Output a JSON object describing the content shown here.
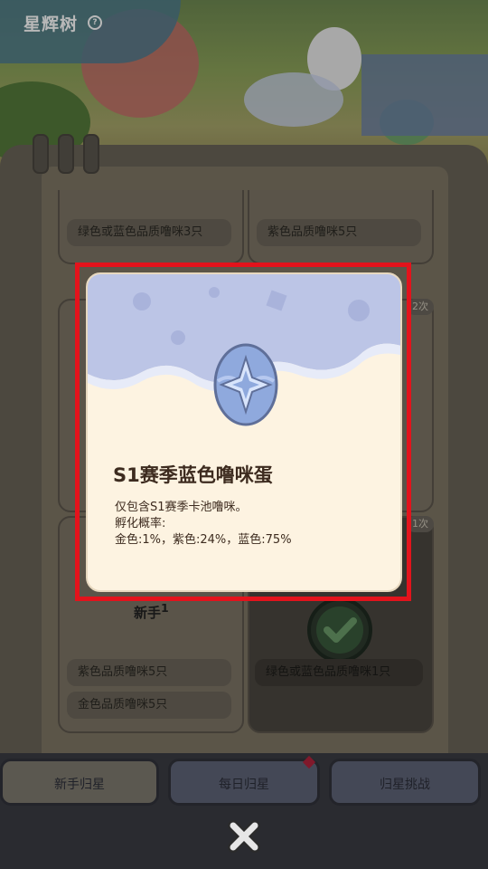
{
  "header": {
    "title": "星辉树",
    "help_icon": "question-icon"
  },
  "cards": {
    "top_left_req": "绿色或蓝色品质噜咪3只",
    "top_right_req": "紫色品质噜咪5只",
    "mid_right_badge": "2次",
    "lower_right_badge": "1次",
    "newbie_label": "新手",
    "newbie_count": "1",
    "bottom_left_req1": "紫色品质噜咪5只",
    "bottom_left_req2": "金色品质噜咪5只",
    "bottom_right_req": "绿色或蓝色品质噜咪1只"
  },
  "tabs": [
    "新手归星",
    "每日归星",
    "归星挑战"
  ],
  "popup": {
    "title": "S1赛季蓝色噜咪蛋",
    "line1": "仅包含S1赛季卡池噜咪。",
    "line2": "孵化概率:",
    "line3": "金色:1%，紫色:24%，蓝色:75%"
  },
  "colors": {
    "highlight_frame": "#e3131c",
    "popup_bg": "#fdf3e1",
    "popup_header": "#b9c3e4",
    "egg": "#8fa9dd"
  }
}
